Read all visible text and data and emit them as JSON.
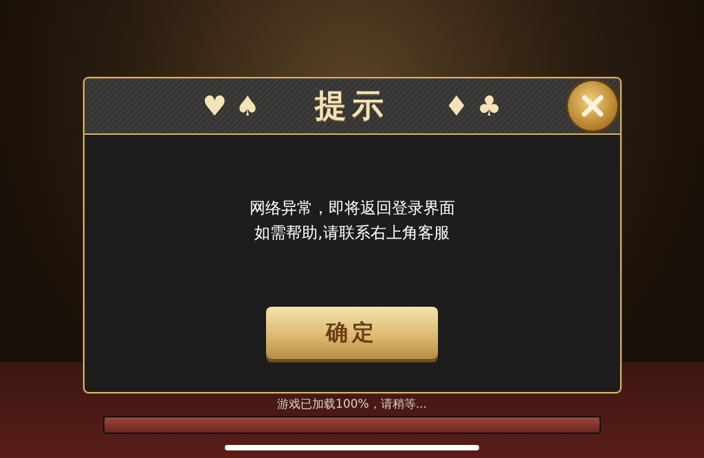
{
  "dialog": {
    "title": "提示",
    "suits_left": [
      "♥",
      "♠"
    ],
    "suits_right": [
      "♦",
      "♣"
    ],
    "message_lines": [
      "网络异常，即将返回登录界面",
      "如需帮助,请联系右上角客服"
    ],
    "confirm_button": "确定"
  },
  "loading": {
    "text": "游戏已加载100%，请稍等...",
    "level": 1
  }
}
